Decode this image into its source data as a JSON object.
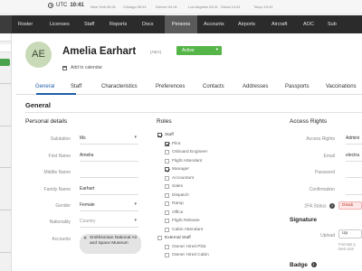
{
  "clock": {
    "label": "UTC",
    "time": "10:41"
  },
  "cities": [
    "New York 06:41",
    "Chicago 05:41",
    "Denver 04:41",
    "Los Angeles 03:41",
    "Dubai 14:41",
    "Tokyo 19:41"
  ],
  "nav": {
    "items": [
      "Roster",
      "Licenses",
      "Staff",
      "Reports",
      "Docs",
      "Persons",
      "Accounts",
      "Airports",
      "Aircraft",
      "AOC",
      "Sub"
    ],
    "active": "Persons"
  },
  "person": {
    "initials": "AE",
    "name": "Amelia Earhart",
    "code": "(AEA)",
    "status": "Active",
    "add_calendar": "Add to calendar"
  },
  "tabs": [
    "General",
    "Staff",
    "Characteristics",
    "Preferences",
    "Contacts",
    "Addresses",
    "Passports",
    "Vaccinations"
  ],
  "active_tab": "General",
  "section_title": "General",
  "personal": {
    "heading": "Personal details",
    "fields": [
      {
        "label": "Salutation",
        "value": "Ms",
        "type": "select"
      },
      {
        "label": "First Name",
        "value": "Amelia",
        "type": "text"
      },
      {
        "label": "Middle Name",
        "value": "",
        "type": "text"
      },
      {
        "label": "Family Name",
        "value": "Earhart",
        "type": "text"
      },
      {
        "label": "Gender",
        "value": "Female",
        "type": "select"
      },
      {
        "label": "Nationality",
        "value": "Country",
        "type": "select-placeholder"
      }
    ],
    "accounts_label": "Accounts",
    "account_chip": "Smithsonian National Air and Space Museum"
  },
  "roles": {
    "heading": "Roles",
    "items": [
      {
        "label": "Staff",
        "checked": true,
        "level": 0
      },
      {
        "label": "Pilot",
        "checked": true,
        "level": 1
      },
      {
        "label": "Onboard Engineer",
        "checked": false,
        "level": 1
      },
      {
        "label": "Flight Attendant",
        "checked": false,
        "level": 1
      },
      {
        "label": "Manager",
        "checked": true,
        "level": 1
      },
      {
        "label": "Accountant",
        "checked": false,
        "level": 1
      },
      {
        "label": "Sales",
        "checked": false,
        "level": 1
      },
      {
        "label": "Dispatch",
        "checked": false,
        "level": 1
      },
      {
        "label": "Ramp",
        "checked": false,
        "level": 1
      },
      {
        "label": "Office",
        "checked": false,
        "level": 1
      },
      {
        "label": "Flight Release",
        "checked": false,
        "level": 1
      },
      {
        "label": "Cabin Attendant",
        "checked": false,
        "level": 1
      },
      {
        "label": "External Staff",
        "checked": false,
        "level": 0
      },
      {
        "label": "Owner Hired Pilot",
        "checked": false,
        "level": 1
      },
      {
        "label": "Owner Hired Cabin",
        "checked": false,
        "level": 1
      }
    ]
  },
  "access": {
    "heading": "Access Rights",
    "fields": [
      {
        "label": "Access Rights",
        "value": "Admini"
      },
      {
        "label": "Email",
        "value": "electra"
      },
      {
        "label": "Password",
        "value": ""
      },
      {
        "label": "Confirmation",
        "value": ""
      }
    ],
    "twofa_label": "2FA Status",
    "twofa_value": "Disab",
    "signature_heading": "Signature",
    "upload_label": "Upload",
    "upload_button": "Up",
    "upload_hint_1": "Formats p",
    "upload_hint_2": "Best size",
    "badge_heading": "Badge"
  }
}
